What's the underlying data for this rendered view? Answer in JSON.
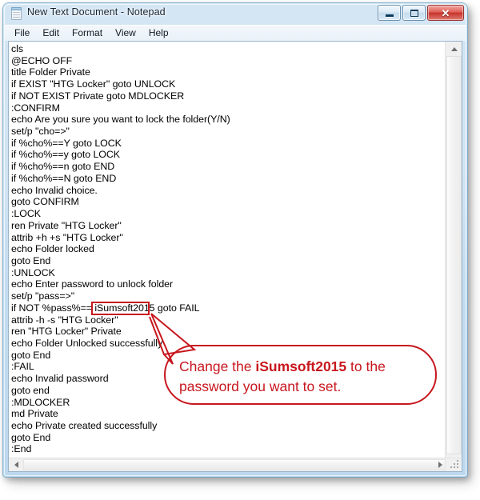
{
  "window": {
    "title": "New Text Document - Notepad",
    "icon": "notepad-icon",
    "accent_color": "#bcd8ee",
    "border_color": "#78aacd",
    "caption_buttons": [
      {
        "name": "minimize",
        "label": "—"
      },
      {
        "name": "maximize",
        "label": "□"
      },
      {
        "name": "close",
        "label": "✕"
      }
    ]
  },
  "menubar": {
    "items": [
      {
        "label": "File"
      },
      {
        "label": "Edit"
      },
      {
        "label": "Format"
      },
      {
        "label": "View"
      },
      {
        "label": "Help"
      }
    ]
  },
  "editor": {
    "lines": [
      "cls",
      "@ECHO OFF",
      "title Folder Private",
      "if EXIST \"HTG Locker\" goto UNLOCK",
      "if NOT EXIST Private goto MDLOCKER",
      ":CONFIRM",
      "echo Are you sure you want to lock the folder(Y/N)",
      "set/p \"cho=>\"",
      "if %cho%==Y goto LOCK",
      "if %cho%==y goto LOCK",
      "if %cho%==n goto END",
      "if %cho%==N goto END",
      "echo Invalid choice.",
      "goto CONFIRM",
      ":LOCK",
      "ren Private \"HTG Locker\"",
      "attrib +h +s \"HTG Locker\"",
      "echo Folder locked",
      "goto End",
      ":UNLOCK",
      "echo Enter password to unlock folder",
      "set/p \"pass=>\"",
      "if NOT %pass%== iSumsoft2015 goto FAIL",
      "attrib -h -s \"HTG Locker\"",
      "ren \"HTG Locker\" Private",
      "echo Folder Unlocked successfully",
      "goto End",
      ":FAIL",
      "echo Invalid password",
      "goto end",
      ":MDLOCKER",
      "md Private",
      "echo Private created successfully",
      "goto End",
      ":End"
    ]
  },
  "scrollbars": {
    "vertical": {
      "up_arrow": "▲",
      "down_arrow": "▼"
    },
    "horizontal": {
      "left_arrow": "◀",
      "right_arrow": "▶"
    }
  },
  "annotation": {
    "highlight_target": "iSumsoft2015",
    "color": "#c8171e",
    "callout_prefix": "Change the ",
    "callout_bold": "iSumsoft2015",
    "callout_suffix": " to the password you want to set."
  }
}
